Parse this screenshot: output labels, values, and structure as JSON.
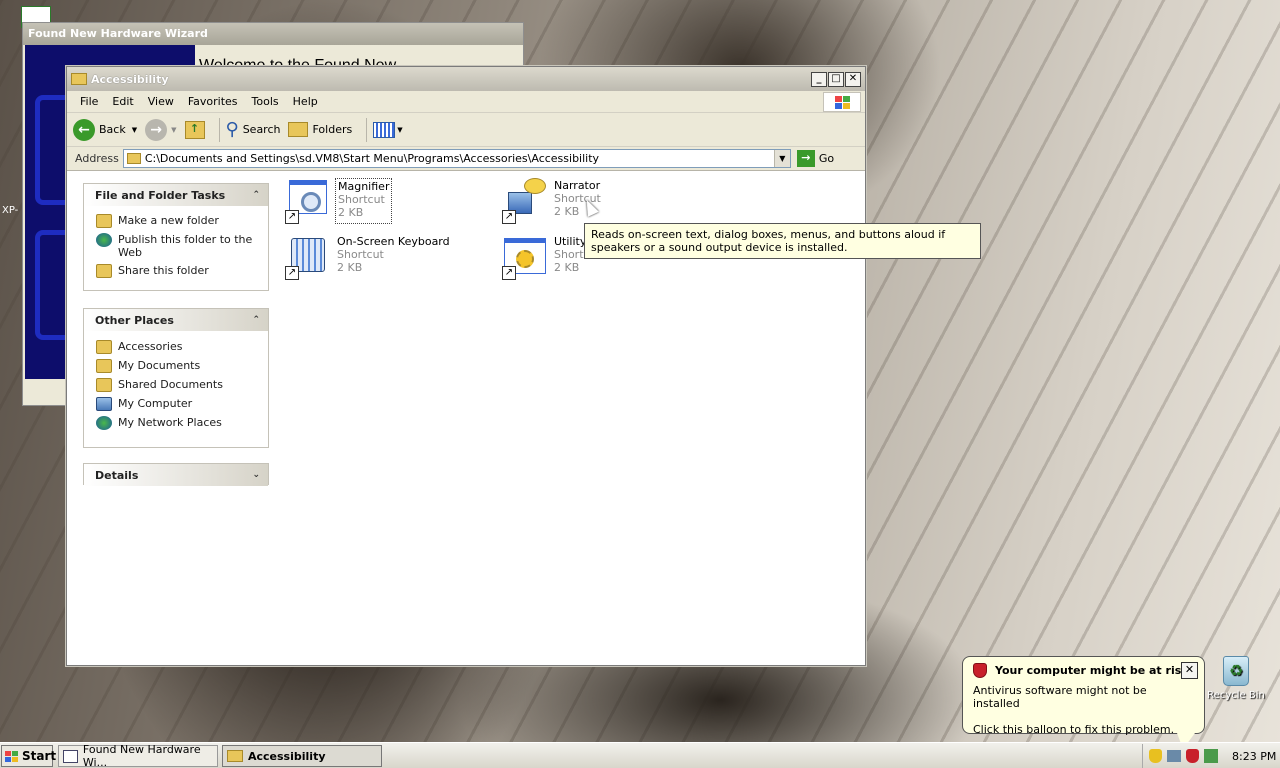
{
  "desktop": {
    "recycle_bin_label": "Recycle Bin",
    "partial_label": "XP-"
  },
  "fnh_window": {
    "title": "Found New Hardware Wizard",
    "heading": "Welcome to the Found New"
  },
  "explorer": {
    "title": "Accessibility",
    "menu": [
      "File",
      "Edit",
      "View",
      "Favorites",
      "Tools",
      "Help"
    ],
    "toolbar": {
      "back": "Back",
      "search": "Search",
      "folders": "Folders"
    },
    "address": {
      "label": "Address",
      "path": "C:\\Documents and Settings\\sd.VM8\\Start Menu\\Programs\\Accessories\\Accessibility",
      "go": "Go"
    },
    "file_tasks": {
      "title": "File and Folder Tasks",
      "items": [
        "Make a new folder",
        "Publish this folder to the Web",
        "Share this folder"
      ]
    },
    "other_places": {
      "title": "Other Places",
      "items": [
        "Accessories",
        "My Documents",
        "Shared Documents",
        "My Computer",
        "My Network Places"
      ]
    },
    "details": {
      "title": "Details"
    },
    "files": [
      {
        "name": "Magnifier",
        "type": "Shortcut",
        "size": "2 KB"
      },
      {
        "name": "Narrator",
        "type": "Shortcut",
        "size": "2 KB"
      },
      {
        "name": "On-Screen Keyboard",
        "type": "Shortcut",
        "size": "2 KB"
      },
      {
        "name": "Utility",
        "type": "Shortc",
        "size": "2 KB"
      }
    ],
    "tooltip": "Reads on-screen text, dialog boxes, menus, and buttons aloud if speakers or a sound output device is installed."
  },
  "balloon": {
    "title": "Your computer might be at risk",
    "line1": "Antivirus software might not be installed",
    "line2": "Click this balloon to fix this problem."
  },
  "taskbar": {
    "start": "Start",
    "tasks": [
      "Found New Hardware Wi...",
      "Accessibility"
    ],
    "clock": "8:23 PM"
  },
  "colors": {
    "balloon_bg": "#ffffe1",
    "wizard_banner": "#0d0d6b",
    "back_green": "#3a9a2a"
  }
}
